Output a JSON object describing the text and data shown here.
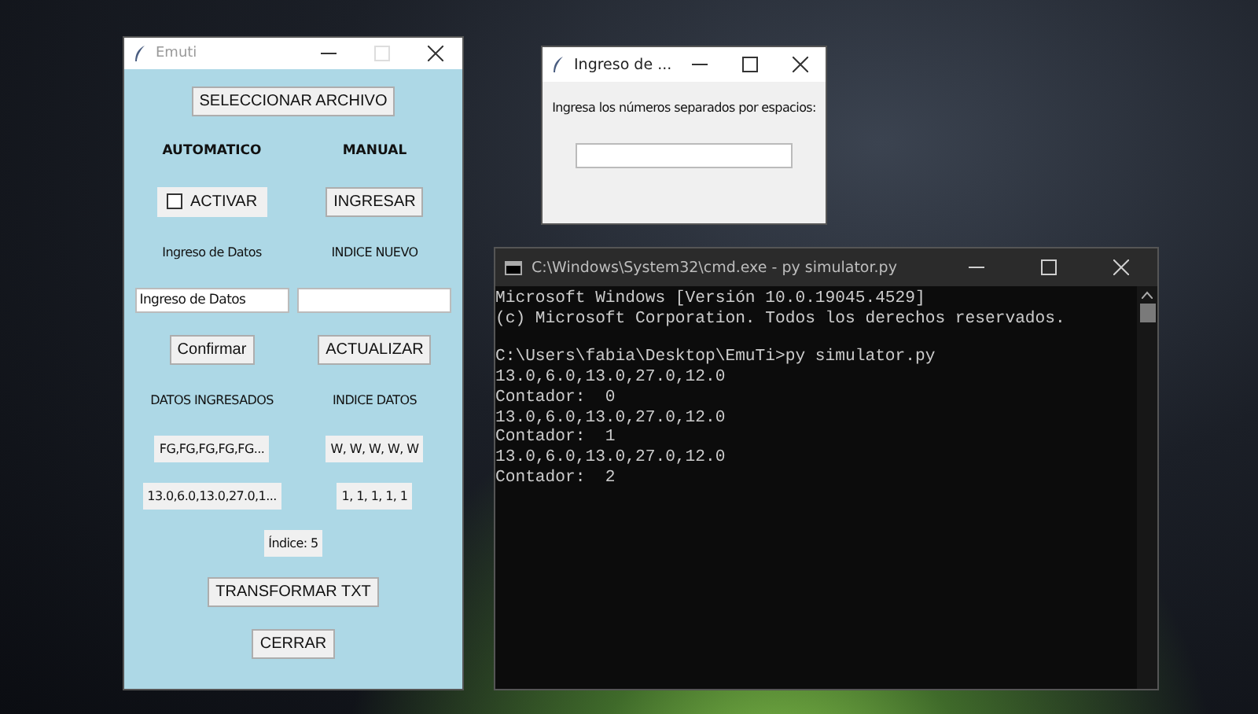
{
  "main_window": {
    "title": "Emuti",
    "select_button": "SELECCIONAR ARCHIVO",
    "automatic": {
      "heading": "AUTOMATICO",
      "activate": {
        "label": "ACTIVAR",
        "checked": false
      },
      "input_label": "Ingreso de Datos",
      "input_value": "Ingreso de Datos",
      "confirm_button": "Confirmar",
      "data_heading": "DATOS INGRESADOS",
      "data_values": [
        "FG,FG,FG,FG,FG...",
        "13.0,6.0,13.0,27.0,1..."
      ]
    },
    "manual": {
      "heading": "MANUAL",
      "ingresar_button": "INGRESAR",
      "index_label": "INDICE NUEVO",
      "update_button": "ACTUALIZAR",
      "index_heading": "INDICE DATOS",
      "index_values": [
        "W, W, W, W, W",
        "1, 1, 1, 1, 1"
      ]
    },
    "index_text": "Índice: 5",
    "transform_button": "TRANSFORMAR TXT",
    "close_button": "CERRAR"
  },
  "input_dialog": {
    "title": "Ingreso de ...",
    "prompt": "Ingresa los números separados por espacios:"
  },
  "console_window": {
    "title": "C:\\Windows\\System32\\cmd.exe - py  simulator.py",
    "blocks": [
      [
        "Microsoft Windows [Versión 10.0.19045.4529]",
        "(c) Microsoft Corporation. Todos los derechos reservados."
      ],
      [
        "C:\\Users\\fabia\\Desktop\\EmuTi>py simulator.py",
        "13.0,6.0,13.0,27.0,12.0",
        "Contador:  0",
        "13.0,6.0,13.0,27.0,12.0",
        "Contador:  1",
        "13.0,6.0,13.0,27.0,12.0",
        "Contador:  2"
      ]
    ]
  }
}
